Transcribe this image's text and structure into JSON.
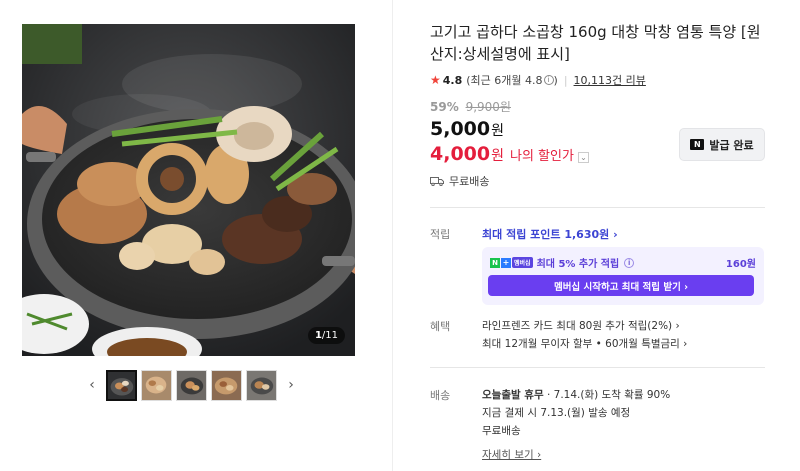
{
  "gallery": {
    "counter_current": "1",
    "counter_total": "/11",
    "prev_arrow": "‹",
    "next_arrow": "›",
    "thumbnails": [
      "thumb-1",
      "thumb-2",
      "thumb-3",
      "thumb-4",
      "thumb-5"
    ]
  },
  "product": {
    "title": "고기고 곱하다 소곱창 160g 대창 막창 염통 특양 [원산지:상세설명에 표시]",
    "rating": {
      "star": "★",
      "score": "4.8",
      "recent": "(최근 6개월 4.8",
      "recent_close": ")",
      "info": "i",
      "reviews": "10,113건 리뷰"
    },
    "discount_rate": "59%",
    "original_price": "9,900원",
    "price": "5,000",
    "price_unit": "원",
    "my_price": "4,000",
    "my_price_unit": "원",
    "my_price_label": "나의 할인가",
    "coupon_button": "발급 완료",
    "coupon_icon": "N",
    "shipping_free": "무료배송"
  },
  "points": {
    "label": "적립",
    "max_points": "최대 적립 포인트 1,630원 ›",
    "member_extra": "최대 5% 추가 적립",
    "member_amount": "160원",
    "member_cta": "멤버십 시작하고 최대 적립 받기 ›",
    "badge_n": "N",
    "badge_plus": "+",
    "badge_ms": "멤버십"
  },
  "benefits": {
    "label": "혜택",
    "line1": "라인프렌즈 카드 최대 80원 추가 적립(2%) ›",
    "line2": "최대 12개월 무이자 할부 • 60개월 특별금리 ›"
  },
  "delivery": {
    "label": "배송",
    "line1_bold": "오늘출발 휴무",
    "line1_rest": " · 7.14.(화) 도착 확률 90%",
    "line2": "지금 결제 시 7.13.(월) 발송 예정",
    "line3": "무료배송",
    "details_link": "자세히 보기 ›"
  },
  "colors": {
    "accent_red": "#e41e3c",
    "membership_purple": "#6a3ef0",
    "points_blue": "#3c44d3"
  }
}
